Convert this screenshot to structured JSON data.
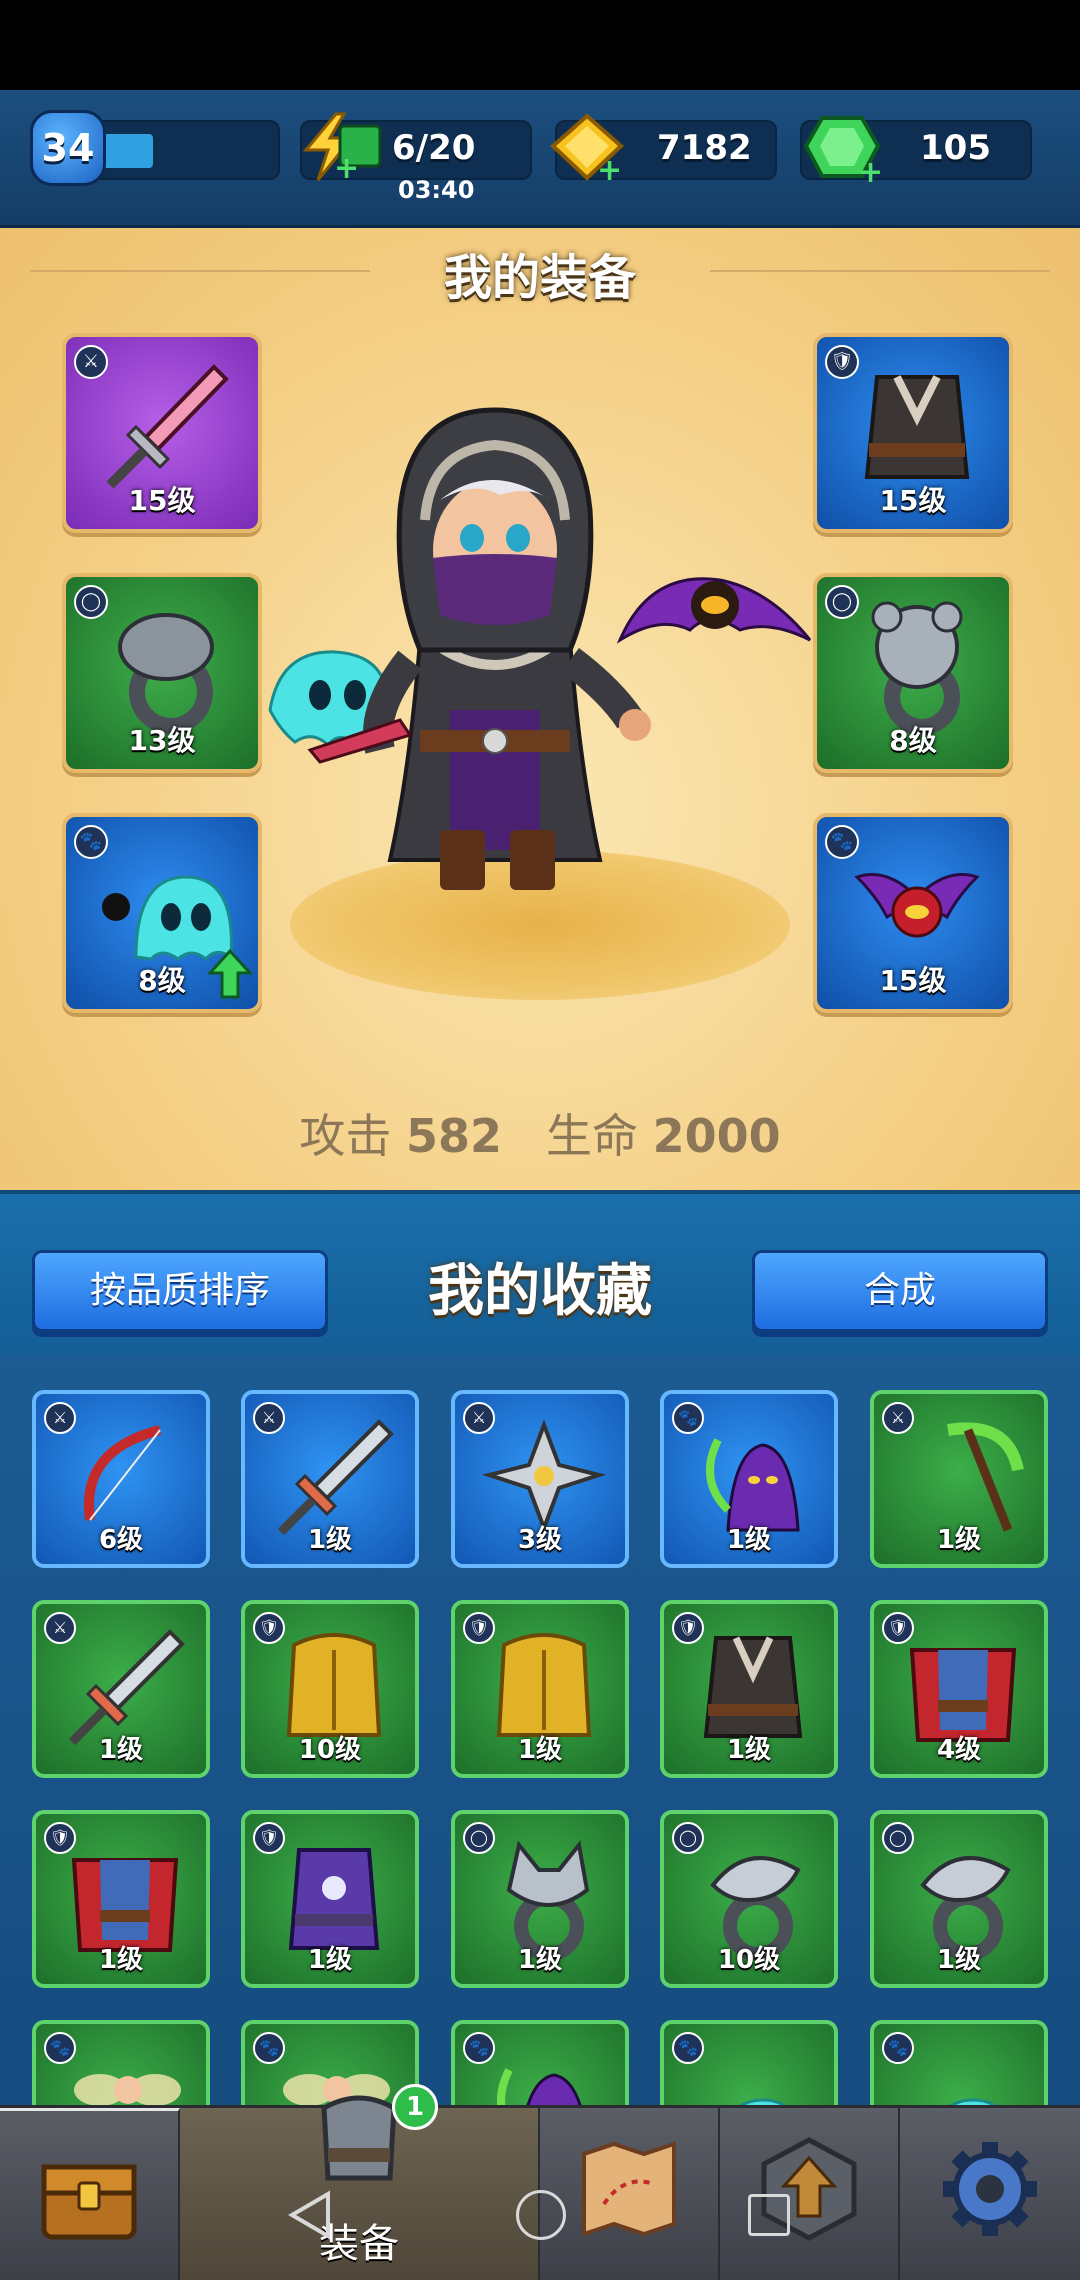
{
  "resources": {
    "player_level": "34",
    "xp_progress": 0.32,
    "energy": "6/20",
    "energy_timer": "03:40",
    "gold": "7182",
    "gems": "105"
  },
  "equipment": {
    "title": "我的装备",
    "slots": [
      {
        "name": "weapon-slot",
        "level": "15级",
        "rarity": "purple",
        "type_icon": "weapon-icon",
        "art": "sword-icon"
      },
      {
        "name": "armor-slot",
        "level": "15级",
        "rarity": "blue",
        "type_icon": "armor-icon",
        "art": "vest-icon"
      },
      {
        "name": "ring-slot-1",
        "level": "13级",
        "rarity": "green",
        "type_icon": "ring-icon",
        "art": "snake-ring-icon"
      },
      {
        "name": "ring-slot-2",
        "level": "8级",
        "rarity": "green",
        "type_icon": "ring-icon",
        "art": "bear-ring-icon"
      },
      {
        "name": "pet-slot-1",
        "level": "8级",
        "rarity": "blue",
        "type_icon": "pet-icon",
        "art": "ghost-pet-icon",
        "upgradable": true
      },
      {
        "name": "pet-slot-2",
        "level": "15级",
        "rarity": "blue",
        "type_icon": "pet-icon",
        "art": "bat-pet-icon"
      }
    ],
    "stats": {
      "attack_label": "攻击",
      "attack_value": "582",
      "hp_label": "生命",
      "hp_value": "2000"
    }
  },
  "collection": {
    "title": "我的收藏",
    "sort_button": "按品质排序",
    "merge_button": "合成",
    "items": [
      {
        "level": "6级",
        "rarity": "blue",
        "type_icon": "weapon-icon",
        "art": "bow-icon"
      },
      {
        "level": "1级",
        "rarity": "blue",
        "type_icon": "weapon-icon",
        "art": "sword-icon"
      },
      {
        "level": "3级",
        "rarity": "blue",
        "type_icon": "weapon-icon",
        "art": "shuriken-icon"
      },
      {
        "level": "1级",
        "rarity": "blue",
        "type_icon": "pet-icon",
        "art": "reaper-pet-icon"
      },
      {
        "level": "1级",
        "rarity": "green",
        "type_icon": "weapon-icon",
        "art": "scythe-icon"
      },
      {
        "level": "1级",
        "rarity": "green",
        "type_icon": "weapon-icon",
        "art": "sword-icon"
      },
      {
        "level": "10级",
        "rarity": "green",
        "type_icon": "armor-icon",
        "art": "gold-armor-icon"
      },
      {
        "level": "1级",
        "rarity": "green",
        "type_icon": "armor-icon",
        "art": "gold-armor-icon"
      },
      {
        "level": "1级",
        "rarity": "green",
        "type_icon": "armor-icon",
        "art": "vest-icon"
      },
      {
        "level": "4级",
        "rarity": "green",
        "type_icon": "armor-icon",
        "art": "cape-armor-icon"
      },
      {
        "level": "1级",
        "rarity": "green",
        "type_icon": "armor-icon",
        "art": "cape-armor-icon"
      },
      {
        "level": "1级",
        "rarity": "green",
        "type_icon": "armor-icon",
        "art": "robe-armor-icon"
      },
      {
        "level": "1级",
        "rarity": "green",
        "type_icon": "ring-icon",
        "art": "wolf-ring-icon"
      },
      {
        "level": "10级",
        "rarity": "green",
        "type_icon": "ring-icon",
        "art": "eagle-ring-icon"
      },
      {
        "level": "1级",
        "rarity": "green",
        "type_icon": "ring-icon",
        "art": "eagle-ring-icon"
      },
      {
        "level": "",
        "rarity": "green",
        "type_icon": "pet-icon",
        "art": "fairy-pet-icon"
      },
      {
        "level": "",
        "rarity": "green",
        "type_icon": "pet-icon",
        "art": "fairy-pet-icon"
      },
      {
        "level": "",
        "rarity": "green",
        "type_icon": "pet-icon",
        "art": "reaper-pet-icon"
      },
      {
        "level": "",
        "rarity": "green",
        "type_icon": "pet-icon",
        "art": "ghost-pet-icon"
      },
      {
        "level": "",
        "rarity": "green",
        "type_icon": "pet-icon",
        "art": "ghost-pet-icon"
      }
    ]
  },
  "nav": {
    "tabs": [
      {
        "name": "tab-chest",
        "icon": "chest-icon",
        "label": ""
      },
      {
        "name": "tab-equipment",
        "icon": "armor-icon",
        "label": "装备",
        "badge": "1"
      },
      {
        "name": "tab-map",
        "icon": "map-icon",
        "label": ""
      },
      {
        "name": "tab-upgrade",
        "icon": "upgrade-icon",
        "label": ""
      },
      {
        "name": "tab-settings",
        "icon": "gear-icon",
        "label": ""
      }
    ]
  },
  "colors": {
    "purple": "#8a3bc8",
    "blue": "#1f6fd6",
    "green": "#2b8c38",
    "gold_bg": "#f4cf85"
  }
}
